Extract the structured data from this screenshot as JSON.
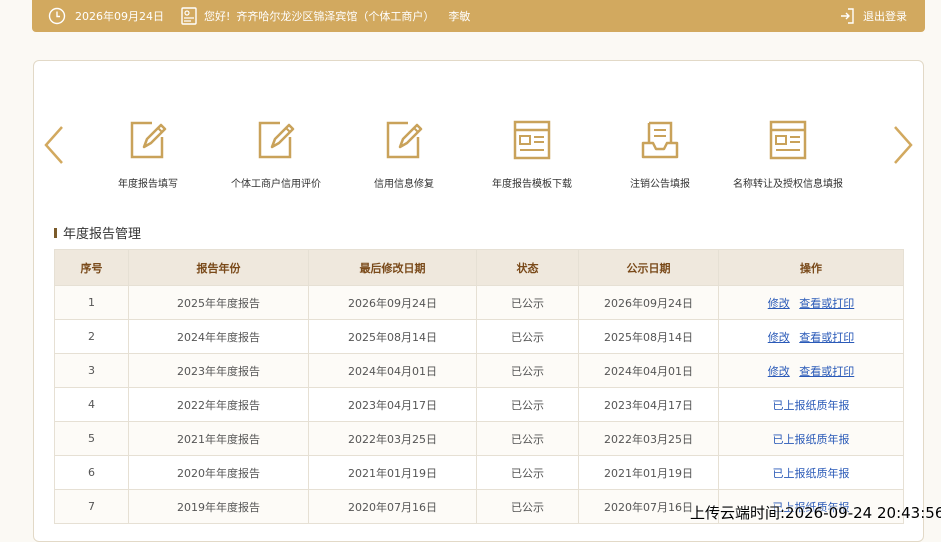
{
  "header": {
    "date": "2026年09月24日",
    "greeting": "您好!",
    "company": "齐齐哈尔龙沙区锦泽宾馆（个体工商户）",
    "user": "李敏",
    "logout_label": "退出登录"
  },
  "quick_actions": [
    {
      "label": "年度报告填写",
      "icon": "edit-icon"
    },
    {
      "label": "个体工商户信用评价",
      "icon": "edit-icon"
    },
    {
      "label": "信用信息修复",
      "icon": "edit-icon"
    },
    {
      "label": "年度报告模板下载",
      "icon": "template-icon"
    },
    {
      "label": "注销公告填报",
      "icon": "inbox-icon"
    },
    {
      "label": "名称转让及授权信息填报",
      "icon": "template-icon"
    }
  ],
  "section": {
    "title": "年度报告管理"
  },
  "table": {
    "headers": [
      "序号",
      "报告年份",
      "最后修改日期",
      "状态",
      "公示日期",
      "操作"
    ],
    "rows": [
      {
        "no": "1",
        "year": "2025年年度报告",
        "modified": "2026年09月24日",
        "status": "已公示",
        "published": "2026年09月24日",
        "op_modify": "修改",
        "op_view": "查看或打印"
      },
      {
        "no": "2",
        "year": "2024年年度报告",
        "modified": "2025年08月14日",
        "status": "已公示",
        "published": "2025年08月14日",
        "op_modify": "修改",
        "op_view": "查看或打印"
      },
      {
        "no": "3",
        "year": "2023年年度报告",
        "modified": "2024年04月01日",
        "status": "已公示",
        "published": "2024年04月01日",
        "op_modify": "修改",
        "op_view": "查看或打印"
      },
      {
        "no": "4",
        "year": "2022年年度报告",
        "modified": "2023年04月17日",
        "status": "已公示",
        "published": "2023年04月17日",
        "op_text": "已上报纸质年报"
      },
      {
        "no": "5",
        "year": "2021年年度报告",
        "modified": "2022年03月25日",
        "status": "已公示",
        "published": "2022年03月25日",
        "op_text": "已上报纸质年报"
      },
      {
        "no": "6",
        "year": "2020年年度报告",
        "modified": "2021年01月19日",
        "status": "已公示",
        "published": "2021年01月19日",
        "op_text": "已上报纸质年报"
      },
      {
        "no": "7",
        "year": "2019年年度报告",
        "modified": "2020年07月16日",
        "status": "已公示",
        "published": "2020年07月16日",
        "op_text": "已上报纸质年报"
      }
    ]
  },
  "overlay": {
    "upload_time": "上传云端时间:2026-09-24 20:43:56"
  },
  "colors": {
    "accent": "#d2a95f",
    "link": "#2a5ab8",
    "header_bg": "#efe8dd"
  }
}
